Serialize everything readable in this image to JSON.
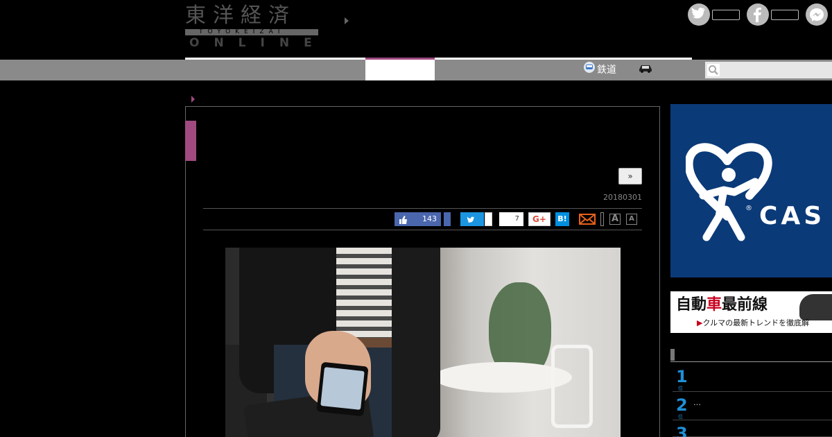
{
  "header": {
    "logo_kanji": "東洋経済",
    "logo_romaji": "TOYOKEIZAI",
    "logo_online": "ONLINE"
  },
  "nav": {
    "items": [
      {
        "label": "鉄道",
        "icon": "train-icon"
      },
      {
        "label": "",
        "icon": "car-icon"
      }
    ]
  },
  "article": {
    "more_label": "»",
    "date": "20180301",
    "share": {
      "fb_like_count": "143",
      "hatena_count": "7",
      "gplus_label": "G+",
      "hatena_label": "B!",
      "font_large": "A",
      "font_small": "A"
    }
  },
  "sidebar": {
    "ad_text": "CAS",
    "ad_reg": "®",
    "banner_title_a": "自動",
    "banner_title_red": "車",
    "banner_title_b": "最前線",
    "banner_sub": "クルマの最新トレンドを徹底解",
    "ranking": [
      {
        "num": "1",
        "text": ""
      },
      {
        "num": "2",
        "text": "…"
      },
      {
        "num": "3",
        "text": ""
      }
    ]
  },
  "colors": {
    "accent": "#a04a80",
    "nav_bg": "#8a8a8a",
    "twitter": "#1b95e0",
    "facebook": "#4a66ad",
    "hatena": "#008fde",
    "ad_bg": "#0b3a78",
    "rank_blue": "#1f8fd6"
  }
}
